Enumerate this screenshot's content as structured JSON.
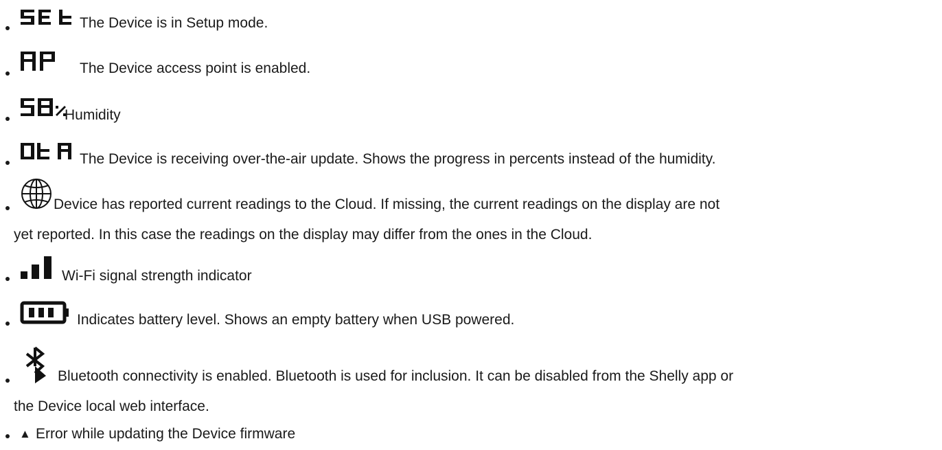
{
  "items": [
    {
      "icon": "seven-segment-set-icon",
      "text": "The Device is in Setup mode."
    },
    {
      "icon": "seven-segment-ap-icon",
      "text": "The Device access point is enabled."
    },
    {
      "icon": "seven-segment-humidity-icon",
      "text": "Humidity"
    },
    {
      "icon": "seven-segment-ota-icon",
      "text": "The Device is receiving over-the-air update. Shows the progress in percents instead of the humidity."
    },
    {
      "icon": "globe-icon",
      "text_line1": "Device has reported current readings to the Cloud. If missing, the current readings on the display are not",
      "text_line2": "yet reported. In this case the readings on the display may differ from the ones in the Cloud."
    },
    {
      "icon": "signal-bars-icon",
      "text": "Wi-Fi signal strength indicator"
    },
    {
      "icon": "battery-icon",
      "text": "Indicates battery level. Shows an empty battery when USB powered."
    },
    {
      "icon": "bluetooth-icon",
      "text_line1": "Bluetooth connectivity is enabled. Bluetooth is used for inclusion. It can be disabled from the Shelly app or",
      "text_line2": "the Device local web interface."
    },
    {
      "icon_glyph": "▲",
      "text": "Error while updating the Device firmware"
    }
  ]
}
